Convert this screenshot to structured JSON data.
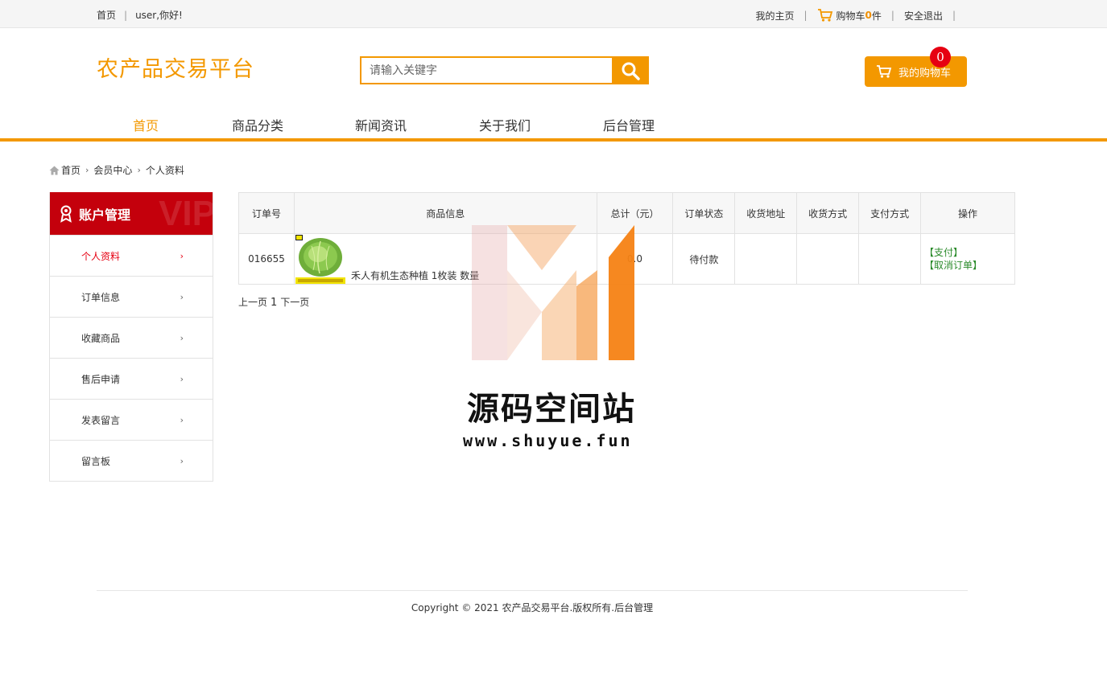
{
  "topbar": {
    "home": "首页",
    "greeting": "user,你好!",
    "my_home": "我的主页",
    "cart_prefix": "购物车",
    "cart_count": "0",
    "cart_suffix": "件",
    "logout": "安全退出"
  },
  "header": {
    "logo": "农产品交易平台",
    "search_placeholder": "请输入关键字",
    "cart_button": "我的购物车",
    "cart_badge": "0"
  },
  "nav": {
    "items": [
      "首页",
      "商品分类",
      "新闻资讯",
      "关于我们",
      "后台管理"
    ],
    "active": "首页"
  },
  "breadcrumb": [
    "首页",
    "会员中心",
    "个人资料"
  ],
  "sidebar": {
    "title": "账户管理",
    "bg_text": "VIP",
    "items": [
      "个人资料",
      "订单信息",
      "收藏商品",
      "售后申请",
      "发表留言",
      "留言板"
    ],
    "active": "个人资料"
  },
  "orders": {
    "headers": [
      "订单号",
      "商品信息",
      "总计（元）",
      "订单状态",
      "收货地址",
      "收货方式",
      "支付方式",
      "操作"
    ],
    "rows": [
      {
        "order_no": "016655",
        "goods_name": "禾人有机生态种植 1枚装 数量",
        "total": "0.0",
        "status": "待付款",
        "address": "",
        "delivery": "",
        "payment": "",
        "action_pay": "【支付】",
        "action_cancel": "【取消订单】"
      }
    ]
  },
  "pager": {
    "prev": "上一页",
    "page": "1",
    "next": "下一页"
  },
  "watermark": {
    "title": "源码空间站",
    "url": "www.shuyue.fun"
  },
  "footer": {
    "copyright": "Copyright © 2021 农产品交易平台.版权所有.后台管理"
  },
  "colors": {
    "accent": "#f39800",
    "sidebar_head": "#c4000c",
    "active_red": "#e60012",
    "action_green": "#2a8a2a"
  }
}
